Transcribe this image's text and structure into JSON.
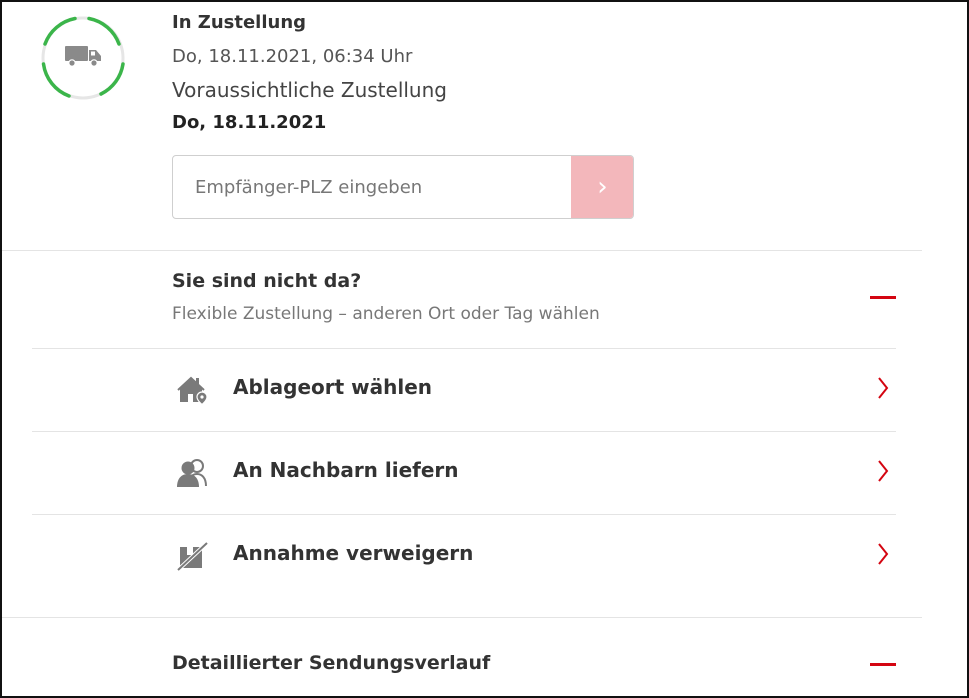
{
  "status": {
    "title": "In Zustellung",
    "timestamp": "Do, 18.11.2021, 06:34 Uhr",
    "eta_label": "Voraussichtliche Zustellung",
    "eta_date": "Do, 18.11.2021",
    "icon": "delivery-truck-icon",
    "ring_color": "#3bb54a"
  },
  "plz": {
    "placeholder": "Empfänger-PLZ eingeben",
    "submit_glyph": "›"
  },
  "absence": {
    "title": "Sie sind nicht da?",
    "subtitle": "Flexible Zustellung – anderen Ort oder Tag wählen",
    "options": [
      {
        "label": "Ablageort wählen",
        "icon": "house-location-icon"
      },
      {
        "label": "An Nachbarn liefern",
        "icon": "neighbors-icon"
      },
      {
        "label": "Annahme verweigern",
        "icon": "refuse-package-icon"
      }
    ]
  },
  "history": {
    "title": "Detaillierter Sendungsverlauf"
  },
  "colors": {
    "accent": "#d40511",
    "button_disabled": "#f3b7bb",
    "ring": "#3bb54a"
  }
}
